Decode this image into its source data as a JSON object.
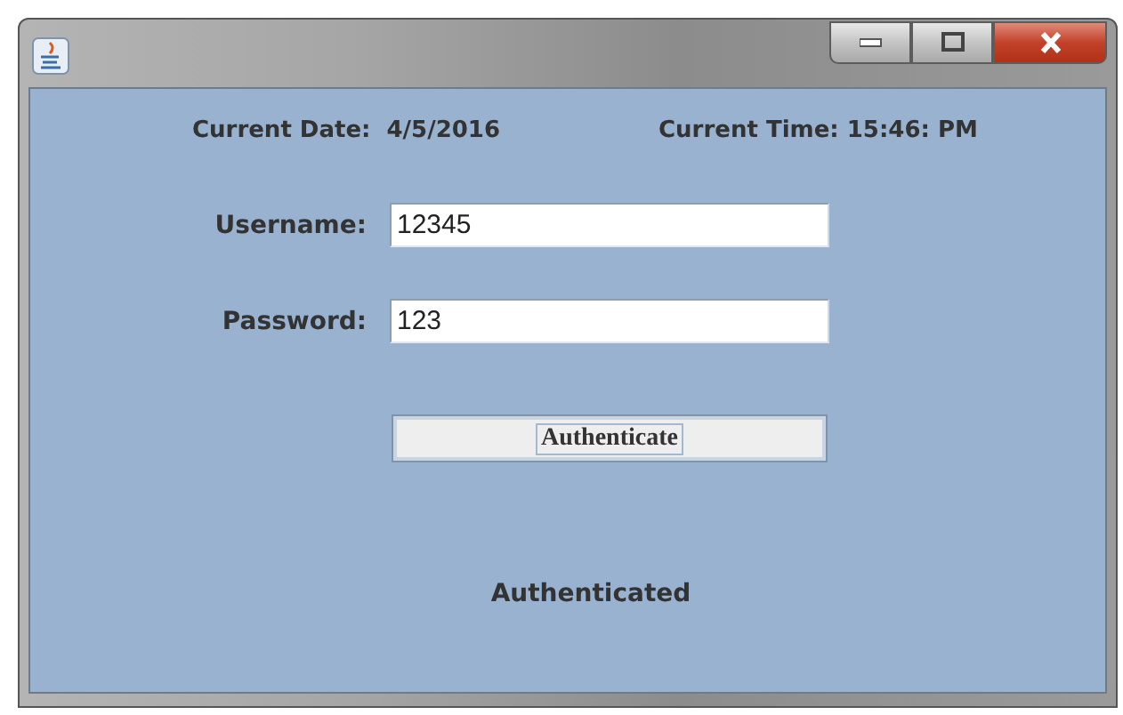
{
  "window": {
    "buttons": [
      {
        "kind": "minimize"
      },
      {
        "kind": "maximize"
      },
      {
        "kind": "close"
      }
    ]
  },
  "date": {
    "label": "Current Date:",
    "value": "4/5/2016"
  },
  "time": {
    "label": "Current Time: 15:46: PM"
  },
  "fields": [
    {
      "label": "Username:",
      "value": "12345"
    },
    {
      "label": "Password:",
      "value": "123"
    }
  ],
  "button": {
    "label": "Authenticate",
    "focused": true
  },
  "status": "Authenticated"
}
